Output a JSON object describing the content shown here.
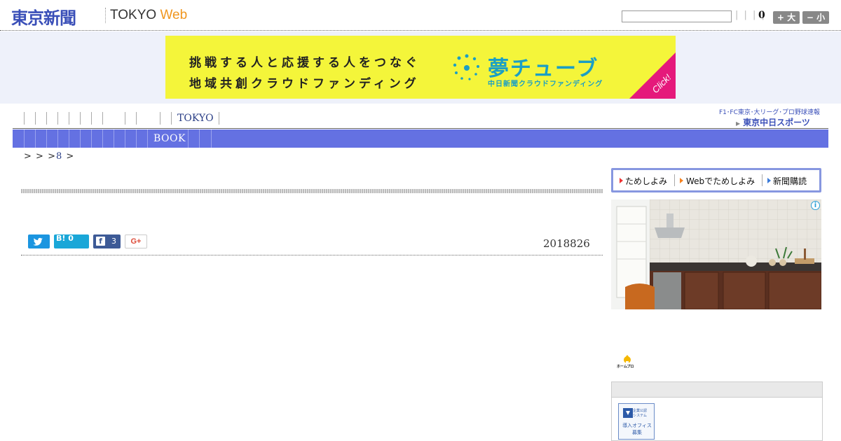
{
  "header": {
    "logo_ja": "東京新聞",
    "logo_en": "TOKYO",
    "logo_web": "Web",
    "dividers": "| | | |",
    "count": "0",
    "font_bigger_label": "+ 大",
    "font_smaller_label": "− 小"
  },
  "banner": {
    "line1": "挑戦する人と応援する人をつなぐ",
    "line2": "地域共創クラウドファンディング",
    "brand": "夢チューブ",
    "brand_sub": "中日新聞クラウドファンディング",
    "click": "Click!",
    "colors": {
      "background": "#f4f53a",
      "brand": "#1b9fc4",
      "corner": "#e5197b"
    }
  },
  "nav": {
    "tokyo_label": "TOKYO",
    "book_label": "BOOK",
    "sports_links": "F1･FC東京･大リーグ･プロ野球速報",
    "sports_logo": "東京中日スポーツ",
    "colors": {
      "bar": "#6471e2"
    }
  },
  "breadcrumb": {
    "sep1": ">",
    "sep2": ">",
    "sep3": ">",
    "num": "8",
    "sep4": ">"
  },
  "article": {
    "hatena_label": "B! 0",
    "fb_count": "3",
    "gplus_label": "G+",
    "date": "2018826"
  },
  "sidebar": {
    "links": [
      "ためしよみ",
      "Webでためしよみ",
      "新聞購読"
    ],
    "ad_info": "i",
    "homepro_label": "ホームプロ",
    "banner_lines": [
      "企業公認",
      "システム",
      "導入オフィス",
      "募集"
    ]
  }
}
